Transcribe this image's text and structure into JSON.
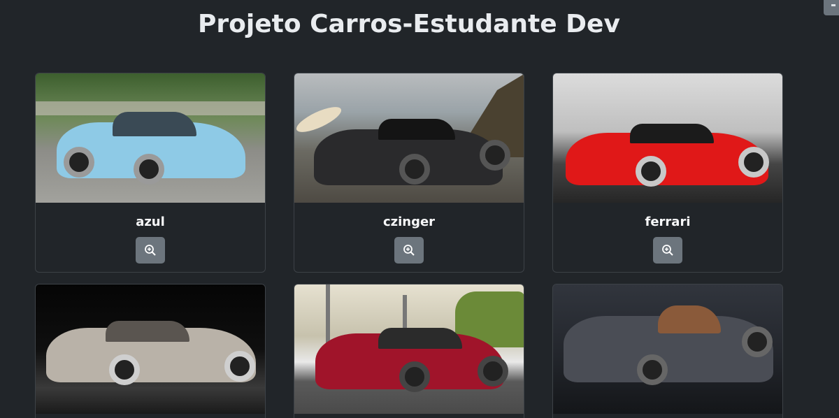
{
  "page": {
    "title": "Projeto Carros-Estudante Dev"
  },
  "cards": [
    {
      "name": "azul",
      "bg_top": "#4b6a3a",
      "bg_bottom": "#8a8a86",
      "car_color": "#8ecae6"
    },
    {
      "name": "czinger",
      "bg_top": "#a7adb2",
      "bg_bottom": "#6d665c",
      "car_color": "#2a2a2c"
    },
    {
      "name": "ferrari",
      "bg_top": "#d7d7d7",
      "bg_bottom": "#3a3a3a",
      "car_color": "#e01818"
    },
    {
      "name": "",
      "bg_top": "#0b0b0b",
      "bg_bottom": "#3b3b3b",
      "car_color": "#b9b2a8"
    },
    {
      "name": "",
      "bg_top": "#d9d4c2",
      "bg_bottom": "#5b5b5b",
      "car_color": "#a0142a"
    },
    {
      "name": "",
      "bg_top": "#2a2e36",
      "bg_bottom": "#15171b",
      "car_color": "#4a4d55"
    }
  ],
  "icons": {
    "zoom": "zoom-in-icon"
  }
}
